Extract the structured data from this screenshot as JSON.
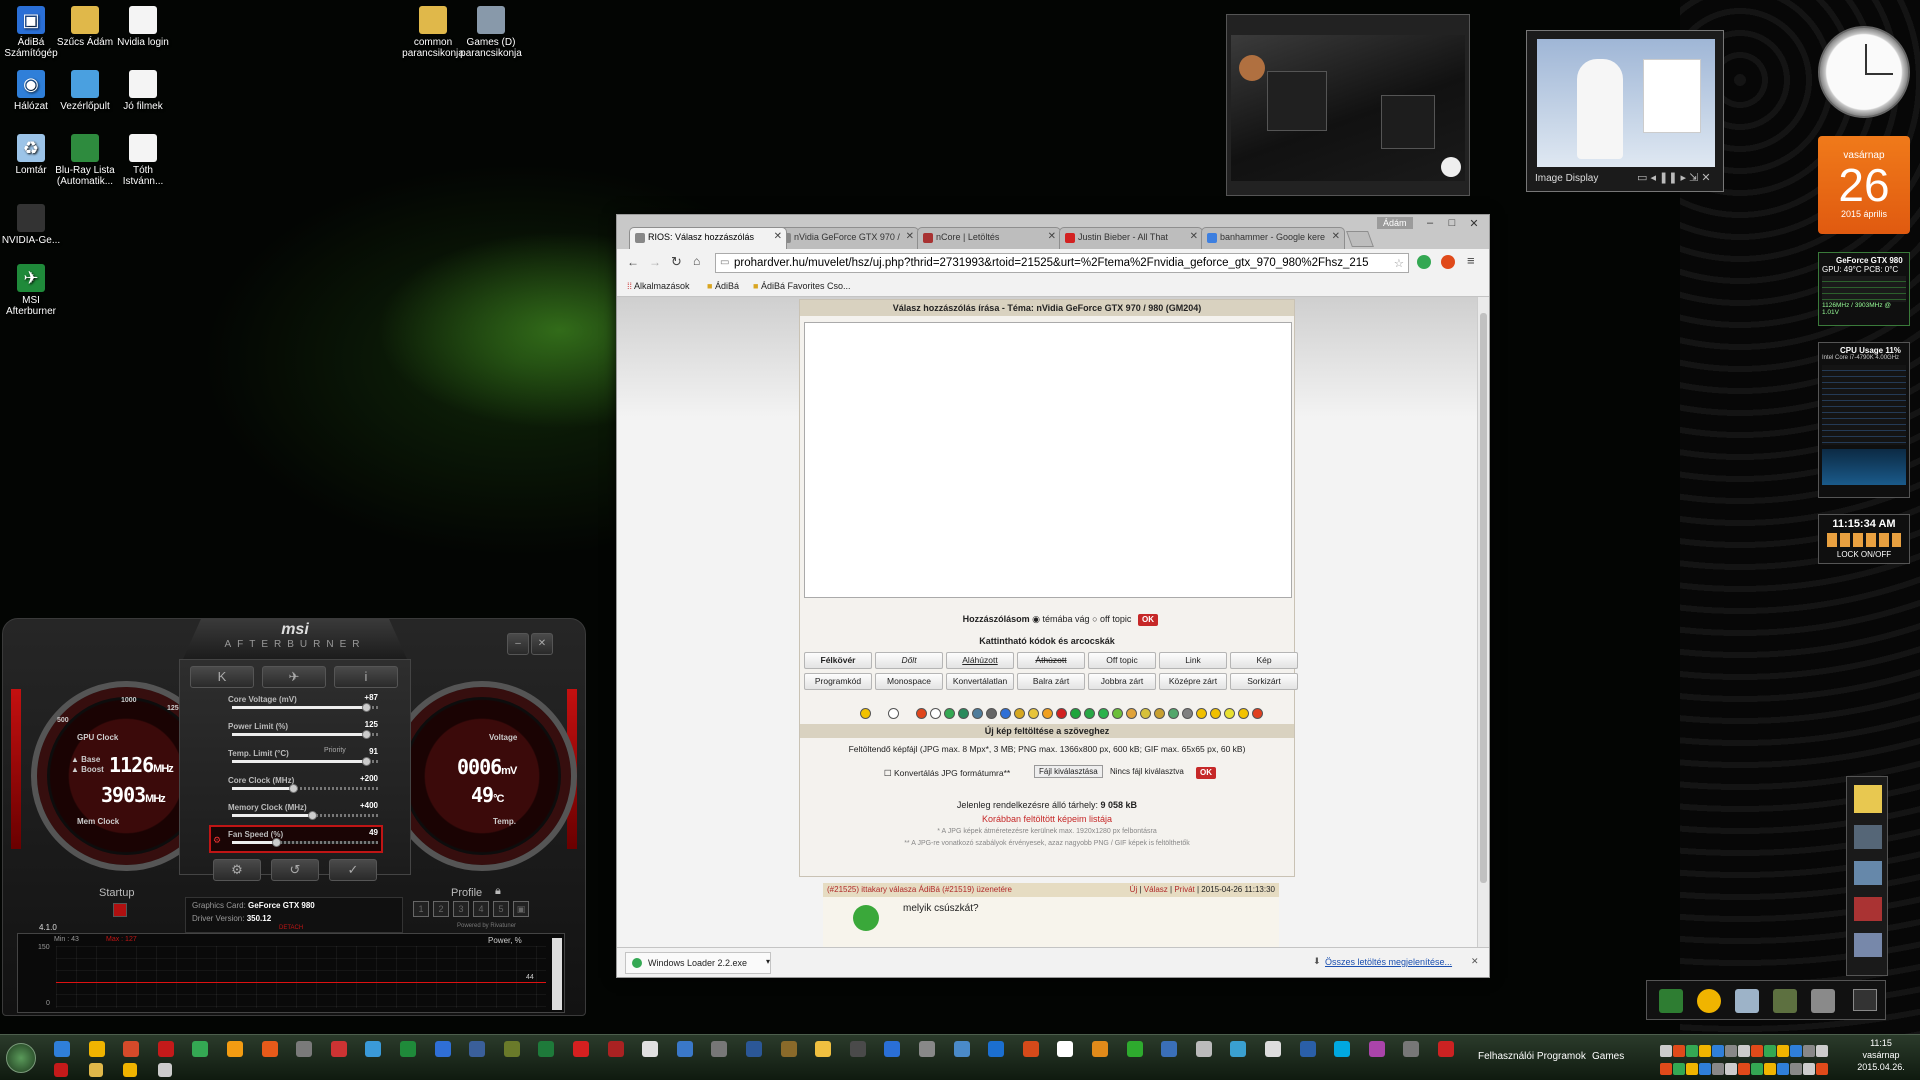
{
  "desktop_icons": [
    {
      "label": "ÁdiBá Számítógép",
      "icon": "computer-icon"
    },
    {
      "label": "Szűcs Ádám",
      "icon": "folder-icon"
    },
    {
      "label": "Nvidia login",
      "icon": "document-icon"
    },
    {
      "label": "Hálózat",
      "icon": "network-icon"
    },
    {
      "label": "Vezérlőpult",
      "icon": "control-panel-icon"
    },
    {
      "label": "Jó filmek",
      "icon": "document-icon"
    },
    {
      "label": "Lomtár",
      "icon": "recycle-bin-icon"
    },
    {
      "label": "Blu-Ray Lista (Automatik...",
      "icon": "spreadsheet-icon"
    },
    {
      "label": "Tóth Istvánn...",
      "icon": "document-icon"
    },
    {
      "label": "NVIDIA-Ge...",
      "icon": "nvidia-icon"
    },
    {
      "label": "MSI Afterburner",
      "icon": "afterburner-icon"
    },
    {
      "label": "common parancsikonja",
      "icon": "folder-icon"
    },
    {
      "label": "Games (D) parancsikonja",
      "icon": "drive-icon"
    }
  ],
  "afterburner": {
    "logo": "msi",
    "subtitle": "AFTERBURNER",
    "gpu_clock_label": "GPU Clock",
    "base_label": "Base",
    "boost_label": "Boost",
    "gpu_clock_value": "1126",
    "gpu_clock_unit": "MHz",
    "mem_clock_value": "3903",
    "mem_clock_unit": "MHz",
    "mem_clock_label": "Mem Clock",
    "voltage_label": "Voltage",
    "voltage_value": "0006",
    "voltage_unit": "mV",
    "temp_value": "49",
    "temp_unit": "°C",
    "temp_label": "Temp.",
    "gauge_ticks": [
      "500",
      "1000",
      "1250"
    ],
    "sliders": [
      {
        "label": "Core Voltage (mV)",
        "value": "+87",
        "fraction": 0.92
      },
      {
        "label": "Power Limit (%)",
        "value": "125",
        "fraction": 0.92
      },
      {
        "label": "Temp. Limit (°C)",
        "value": "91",
        "fraction": 0.92
      },
      {
        "label": "Core Clock (MHz)",
        "value": "+200",
        "fraction": 0.42
      },
      {
        "label": "Memory Clock (MHz)",
        "value": "+400",
        "fraction": 0.55
      },
      {
        "label": "Fan Speed (%)",
        "value": "49",
        "fraction": 0.3
      }
    ],
    "priority_label": "Priority",
    "startup_label": "Startup",
    "profile_label": "Profile",
    "profile_slots": [
      "1",
      "2",
      "3",
      "4",
      "5"
    ],
    "graphics_card_label": "Graphics Card:",
    "graphics_card_value": "GeForce GTX 980",
    "driver_label": "Driver Version:",
    "driver_value": "350.12",
    "detach_label": "DETACH",
    "powered_by": "Powered by Rivatuner",
    "version": "4.1.0",
    "graph": {
      "min_label": "Min : 43",
      "max_label": "Max : 127",
      "title": "Power, %",
      "y_top": "150",
      "y_bottom": "0",
      "current": "44"
    }
  },
  "browser": {
    "profile_name": "Ádám",
    "tabs": [
      {
        "title": "RIOS: Válasz hozzászólás",
        "active": true,
        "color": "#888888"
      },
      {
        "title": "nVidia GeForce GTX 970 /",
        "active": false,
        "color": "#888888"
      },
      {
        "title": "nCore | Letöltés",
        "active": false,
        "color": "#a83232"
      },
      {
        "title": "Justin Bieber - All That",
        "active": false,
        "color": "#d32222"
      },
      {
        "title": "banhammer - Google kere",
        "active": false,
        "color": "#3d7fe0"
      }
    ],
    "url": "prohardver.hu/muvelet/hsz/uj.php?thrid=2731993&rtoid=21525&urt=%2Ftema%2Fnvidia_geforce_gtx_970_980%2Fhsz_215",
    "bookmarks": [
      "Alkalmazások",
      "ÁdiBá",
      "ÁdiBá Favorites Cso..."
    ],
    "page": {
      "title": "Válasz hozzászólás írása - Téma: nVidia GeForce GTX 970 / 980 (GM204)",
      "post_type_label": "Hozzászólásom",
      "option_on_topic": "témába vág",
      "option_off_topic": "off topic",
      "ok_label": "OK",
      "codes_title": "Kattintható kódok és arcocskák",
      "code_buttons_row1": [
        "Félkövér",
        "Dőlt",
        "Aláhúzott",
        "Áthúzott",
        "Off topic",
        "Link",
        "Kép"
      ],
      "code_buttons_row2": [
        "Programkód",
        "Monospace",
        "Konvertálatlan",
        "Balra zárt",
        "Jobbra zárt",
        "Középre zárt",
        "Sorkizárt"
      ],
      "smiley_colors": [
        "#f2c200",
        "#ffffff",
        "#e0451b",
        "#ffffff",
        "#34a853",
        "#2a8a5c",
        "#4f7d9c",
        "#666666",
        "#2f6fd6",
        "#d6a820",
        "#e7c43a",
        "#f0a020",
        "#d12020",
        "#1ea43c",
        "#28a745",
        "#2bb24c",
        "#6cbf3a",
        "#e0a33a",
        "#d6c13a",
        "#c8a030",
        "#52a66b",
        "#808080",
        "#f0c000",
        "#f0c000",
        "#e8e030",
        "#f2c200",
        "#e04020"
      ],
      "upload_title": "Új kép feltöltése a szöveghez",
      "upload_desc": "Feltöltendő képfájl (JPG max. 8 Mpx*, 3 MB; PNG max. 1366x800 px, 600 kB; GIF max. 65x65 px, 60 kB)",
      "convert_label": "Konvertálás JPG formátumra**",
      "choose_file_label": "Fájl kiválasztása",
      "no_file_label": "Nincs fájl kiválasztva",
      "storage_text": "Jelenleg rendelkezésre álló tárhely:",
      "storage_value": "9 058 kB",
      "prev_uploads": "Korábban feltöltött képeim listája",
      "note1": "* A JPG képek átméretezésre kerülnek max. 1920x1280 px felbontásra",
      "note2": "** A JPG-re vonatkozó szabályok érvényesek, azaz nagyobb PNG / GIF képek is feltölthetők",
      "reply_header": "(#21525) ittakary válasza ÁdiBá (#21519) üzenetére",
      "reply_actions": [
        "Új",
        "Válasz",
        "Privát"
      ],
      "reply_time": "2015-04-26 11:13:30",
      "reply_body": "melyik csúszkát?"
    },
    "download": {
      "file": "Windows Loader 2.2.exe",
      "show_all": "Összes letöltés megjelenítése..."
    }
  },
  "widgets": {
    "image_display_title": "Image Display",
    "calendar_weekday": "vasárnap",
    "calendar_day": "26",
    "calendar_month": "2015 április",
    "gpu_title": "GeForce GTX 980",
    "gpu_temp": "GPU: 49°C PCB: 0°C",
    "gpu_clock_line": "1126MHz / 3903MHz @ 1.01V",
    "cpu_title": "CPU Usage 11%",
    "cpu_name": "Intel Core i7-4790K 4.00GHz",
    "clock_time": "11:15:34 AM",
    "lock_label": "LOCK ON/OFF"
  },
  "taskbar": {
    "toolbar_labels": [
      "Felhasználói Programok",
      "Games"
    ],
    "time": "11:15",
    "weekday": "vasárnap",
    "date": "2015.04.26."
  }
}
